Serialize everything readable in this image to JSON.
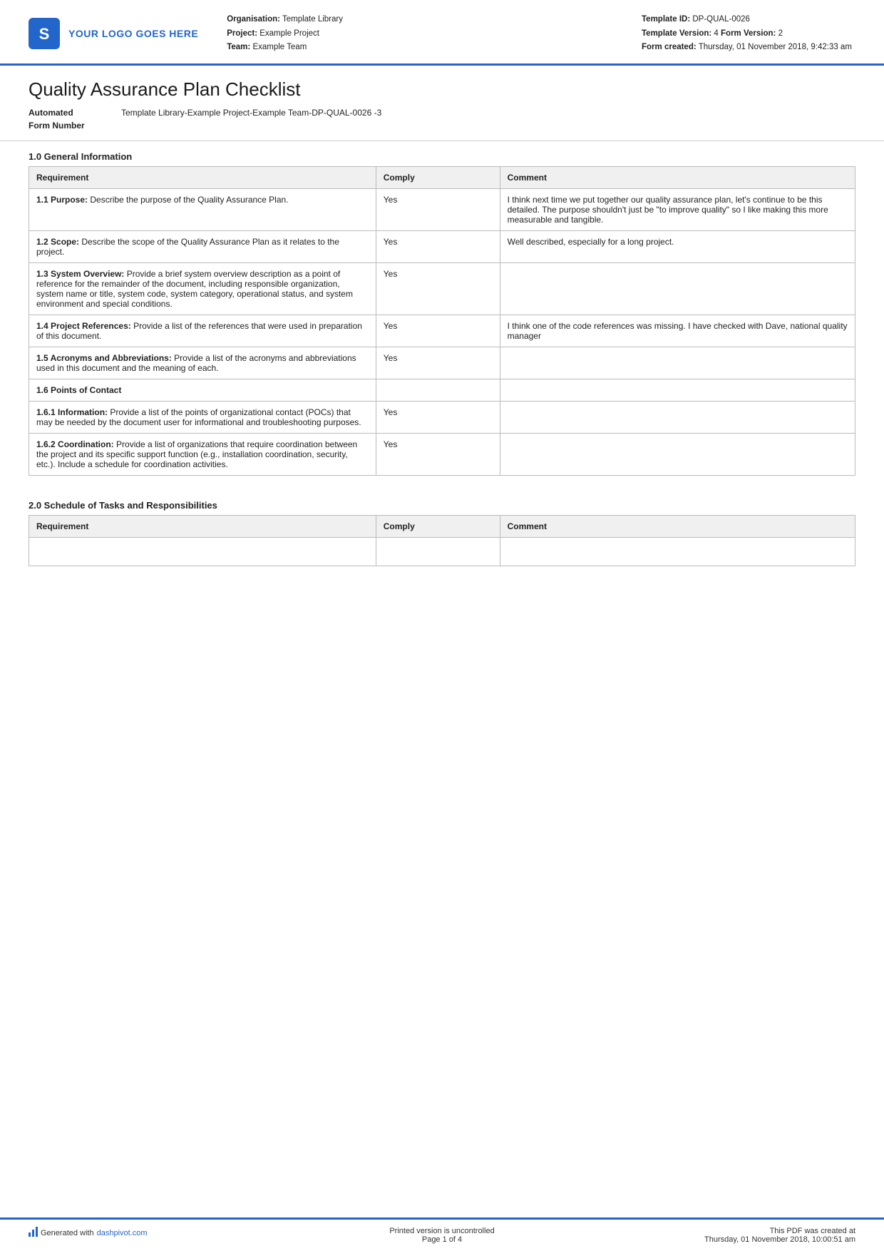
{
  "header": {
    "logo_text": "YOUR LOGO GOES HERE",
    "org_label": "Organisation:",
    "org_value": "Template Library",
    "project_label": "Project:",
    "project_value": "Example Project",
    "team_label": "Team:",
    "team_value": "Example Team",
    "template_id_label": "Template ID:",
    "template_id_value": "DP-QUAL-0026",
    "template_version_label": "Template Version:",
    "template_version_value": "4",
    "form_version_label": "Form Version:",
    "form_version_value": "2",
    "form_created_label": "Form created:",
    "form_created_value": "Thursday, 01 November 2018, 9:42:33 am"
  },
  "document": {
    "title": "Quality Assurance Plan Checklist",
    "form_number_label": "Automated\nForm Number",
    "form_number_value": "Template Library-Example Project-Example Team-DP-QUAL-0026  -3"
  },
  "section1": {
    "heading": "1.0 General Information",
    "table": {
      "col_req": "Requirement",
      "col_comply": "Comply",
      "col_comment": "Comment",
      "rows": [
        {
          "req_bold": "1.1 Purpose:",
          "req_text": " Describe the purpose of the Quality Assurance Plan.",
          "comply": "Yes",
          "comment": "I think next time we put together our quality assurance plan, let's continue to be this detailed. The purpose shouldn't just be \"to improve quality\" so I like making this more measurable and tangible."
        },
        {
          "req_bold": "1.2 Scope:",
          "req_text": " Describe the scope of the Quality Assurance Plan as it relates to the project.",
          "comply": "Yes",
          "comment": "Well described, especially for a long project."
        },
        {
          "req_bold": "1.3 System Overview:",
          "req_text": " Provide a brief system overview description as a point of reference for the remainder of the document, including responsible organization, system name or title, system code, system category, operational status, and system environment and special conditions.",
          "comply": "Yes",
          "comment": ""
        },
        {
          "req_bold": "1.4 Project References:",
          "req_text": " Provide a list of the references that were used in preparation of this document.",
          "comply": "Yes",
          "comment": "I think one of the code references was missing. I have checked with Dave, national quality manager"
        },
        {
          "req_bold": "1.5 Acronyms and Abbreviations:",
          "req_text": " Provide a list of the acronyms and abbreviations used in this document and the meaning of each.",
          "comply": "Yes",
          "comment": ""
        },
        {
          "req_bold": "1.6 Points of Contact",
          "req_text": "",
          "comply": "",
          "comment": "",
          "is_subheader": true
        },
        {
          "req_bold": "1.6.1 Information:",
          "req_text": " Provide a list of the points of organizational contact (POCs) that may be needed by the document user for informational and troubleshooting purposes.",
          "comply": "Yes",
          "comment": ""
        },
        {
          "req_bold": "1.6.2 Coordination:",
          "req_text": " Provide a list of organizations that require coordination between the project and its specific support function (e.g., installation coordination, security, etc.). Include a schedule for coordination activities.",
          "comply": "Yes",
          "comment": ""
        }
      ]
    }
  },
  "section2": {
    "heading": "2.0 Schedule of Tasks and Responsibilities",
    "table": {
      "col_req": "Requirement",
      "col_comply": "Comply",
      "col_comment": "Comment",
      "rows": []
    }
  },
  "footer": {
    "generated_text": "Generated with ",
    "dashpivot_link": "dashpivot.com",
    "center_line1": "Printed version is uncontrolled",
    "center_line2": "Page 1 of 4",
    "right_line1": "This PDF was created at",
    "right_line2": "Thursday, 01 November 2018, 10:00:51 am"
  }
}
